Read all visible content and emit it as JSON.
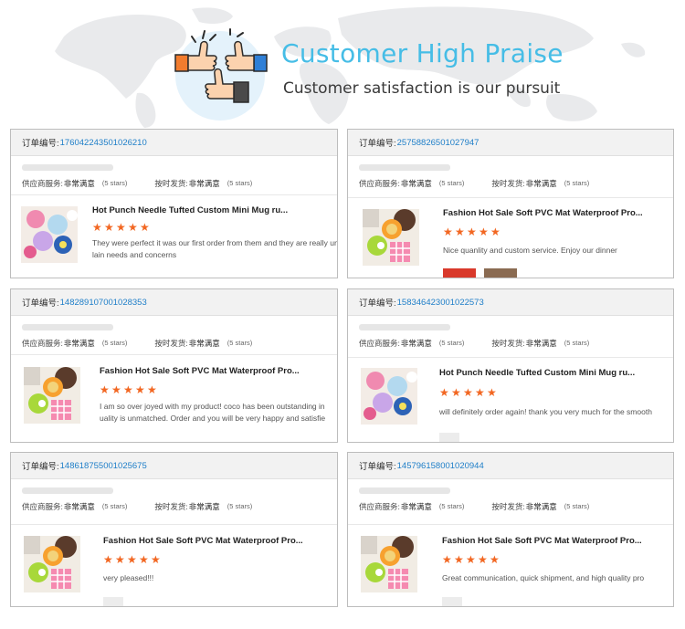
{
  "hero": {
    "title": "Customer High Praise",
    "subtitle": "Customer satisfaction is our pursuit",
    "icon": "thumbs-up-hands-icon"
  },
  "labels": {
    "order_no": "订单编号:",
    "supplier_service": "供应商服务:",
    "on_time_delivery": "按时发货:",
    "rating_text": "非常满意",
    "stars_text": "(5 stars)"
  },
  "colors": {
    "accent": "#46bde6",
    "order_link": "#1e7ec8",
    "star": "#f26722"
  },
  "reviews": [
    {
      "order_number": "176042243501026210",
      "product_title": "Hot Punch Needle Tufted Custom Mini Mug ru...",
      "rating": 5,
      "review_line1": "They were perfect it was our first order from them and they are really und",
      "review_line2": "lain needs and concerns"
    },
    {
      "order_number": "257588265010279​47",
      "product_title": "Fashion Hot Sale Soft PVC Mat Waterproof Pro...",
      "rating": 5,
      "review_line1": "Nice quanlity and custom service. Enjoy our dinner",
      "review_line2": ""
    },
    {
      "order_number": "148289107001028353",
      "product_title": "Fashion Hot Sale Soft PVC Mat Waterproof Pro...",
      "rating": 5,
      "review_line1": "I am so over joyed with my product! coco has been outstanding in",
      "review_line2": "uality is unmatched. Order and you will be very happy and satisfie"
    },
    {
      "order_number": "158346423001022573",
      "product_title": "Hot Punch Needle Tufted Custom Mini Mug ru...",
      "rating": 5,
      "review_line1": "will definitely order again! thank you very much for the smooth",
      "review_line2": ""
    },
    {
      "order_number": "148618755001025675",
      "product_title": "Fashion Hot Sale Soft PVC Mat Waterproof Pro...",
      "rating": 5,
      "review_line1": "very pleased!!!",
      "review_line2": ""
    },
    {
      "order_number": "145796158001020944",
      "product_title": "Fashion Hot Sale Soft PVC Mat Waterproof Pro...",
      "rating": 5,
      "review_line1": "Great communication, quick shipment, and high quality pro",
      "review_line2": ""
    }
  ]
}
